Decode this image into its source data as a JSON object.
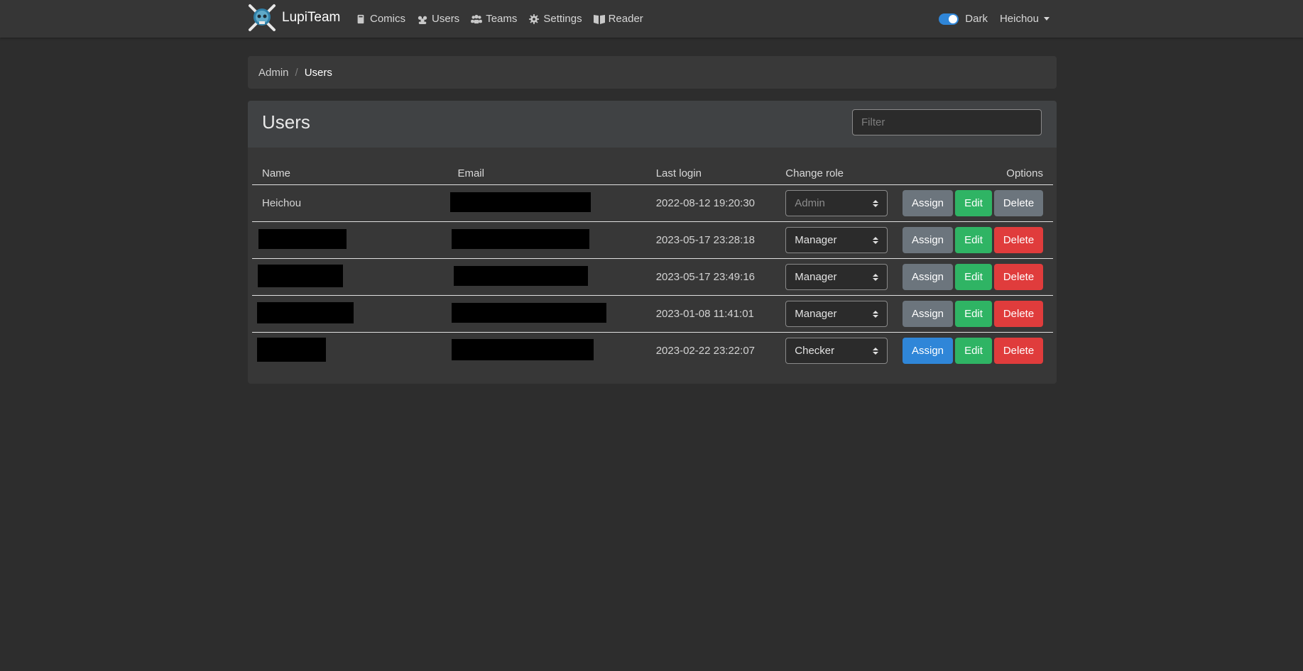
{
  "navbar": {
    "brand": "LupiTeam",
    "links": [
      {
        "label": "Comics",
        "icon": "book-icon"
      },
      {
        "label": "Users",
        "icon": "users-icon"
      },
      {
        "label": "Teams",
        "icon": "teams-icon"
      },
      {
        "label": "Settings",
        "icon": "gear-icon"
      },
      {
        "label": "Reader",
        "icon": "open-book-icon"
      }
    ],
    "theme_label": "Dark",
    "theme_on": true,
    "user": "Heichou"
  },
  "breadcrumb": {
    "parent": "Admin",
    "current": "Users"
  },
  "card": {
    "title": "Users",
    "filter_placeholder": "Filter"
  },
  "table": {
    "headers": {
      "name": "Name",
      "email": "Email",
      "last_login": "Last login",
      "change_role": "Change role",
      "options": "Options"
    },
    "rows": [
      {
        "name": "Heichou",
        "last_login": "2022-08-12 19:20:30",
        "role": "Admin"
      },
      {
        "name": "",
        "last_login": "2023-05-17 23:28:18",
        "role": "Manager"
      },
      {
        "name": "",
        "last_login": "2023-05-17 23:49:16",
        "role": "Manager"
      },
      {
        "name": "",
        "last_login": "2023-01-08 11:41:01",
        "role": "Manager"
      },
      {
        "name": "",
        "last_login": "2023-02-22 23:22:07",
        "role": "Checker"
      }
    ],
    "buttons": {
      "assign": "Assign",
      "edit": "Edit",
      "delete": "Delete"
    }
  },
  "colors": {
    "background": "#2d2d2d",
    "navbar": "#363636",
    "primary": "#2f86d8",
    "success": "#2fb464",
    "danger": "#e03c3c",
    "secondary": "#6c757d"
  }
}
